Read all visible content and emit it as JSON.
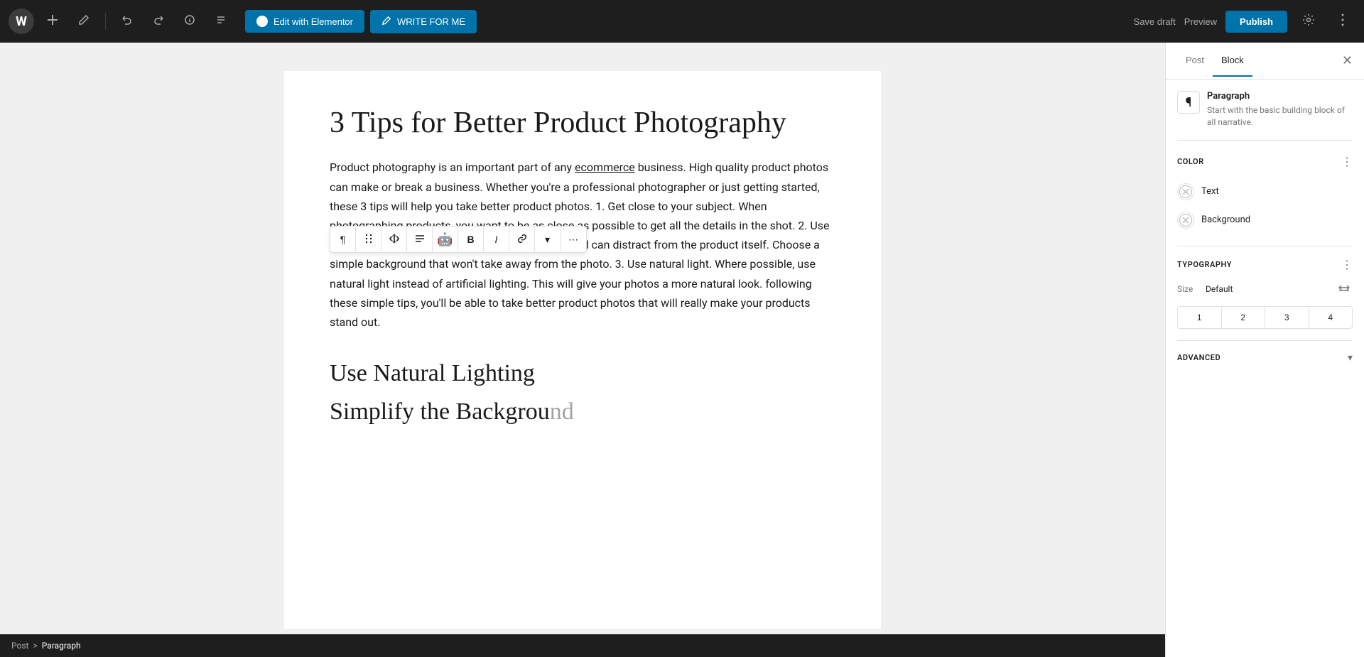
{
  "toolbar": {
    "wp_logo": "W",
    "add_label": "+",
    "tools_label": "✏",
    "undo_label": "↩",
    "redo_label": "↪",
    "info_label": "ℹ",
    "list_view_label": "≡",
    "edit_elementor_label": "Edit with Elementor",
    "write_for_me_label": "WRITE FOR ME",
    "save_draft_label": "Save draft",
    "preview_label": "Preview",
    "publish_label": "Publish",
    "settings_label": "⚙",
    "more_label": "⋮"
  },
  "editor": {
    "title": "3 Tips for Better Product Photography",
    "body": "Product photography is an important part of any ecommerce business. High quality product photos can make or break a business. Whether you're a professional photographer or just getting started, these 3 tips will help you take better product photos. 1. Get close to your subject. When photographing products, you want to be as close as possible to get all the details in the shot. 2. Use a plain background. A busy or cluttered background can distract from the product itself. Choose a simple background that won't take away from the photo. 3. Use natural light. Where possible, use natural light instead of artificial lighting. This will give your photos a more natural look.  following these simple tips, you'll be able to take better product photos that will really make your products stand out.",
    "section_heading": "Use Natural Lighting",
    "partial_heading": "Simplify the Background"
  },
  "block_toolbar": {
    "paragraph_icon": "¶",
    "drag_icon": "⋮⋮",
    "move_icon": "⇅",
    "align_icon": "≡",
    "emoji_icon": "🤖",
    "bold_label": "B",
    "italic_label": "I",
    "link_icon": "🔗",
    "dropdown_icon": "▾",
    "more_icon": "⋯"
  },
  "sidebar": {
    "tab_post_label": "Post",
    "tab_block_label": "Block",
    "active_tab": "Block",
    "close_label": "✕",
    "block_name": "Paragraph",
    "block_description": "Start with the basic building block of all narrative.",
    "color_section_label": "Color",
    "text_label": "Text",
    "background_label": "Background",
    "typography_section_label": "Typography",
    "size_label": "Size",
    "size_value": "Default",
    "heading_sizes": [
      "1",
      "2",
      "3",
      "4"
    ],
    "advanced_section_label": "Advanced",
    "typography_more_icon": "⋮",
    "color_more_icon": "⋮"
  },
  "breadcrumb": {
    "items": [
      "Post",
      ">",
      "Paragraph"
    ]
  },
  "colors": {
    "accent": "#0073aa",
    "toolbar_bg": "#1e1e1e"
  }
}
